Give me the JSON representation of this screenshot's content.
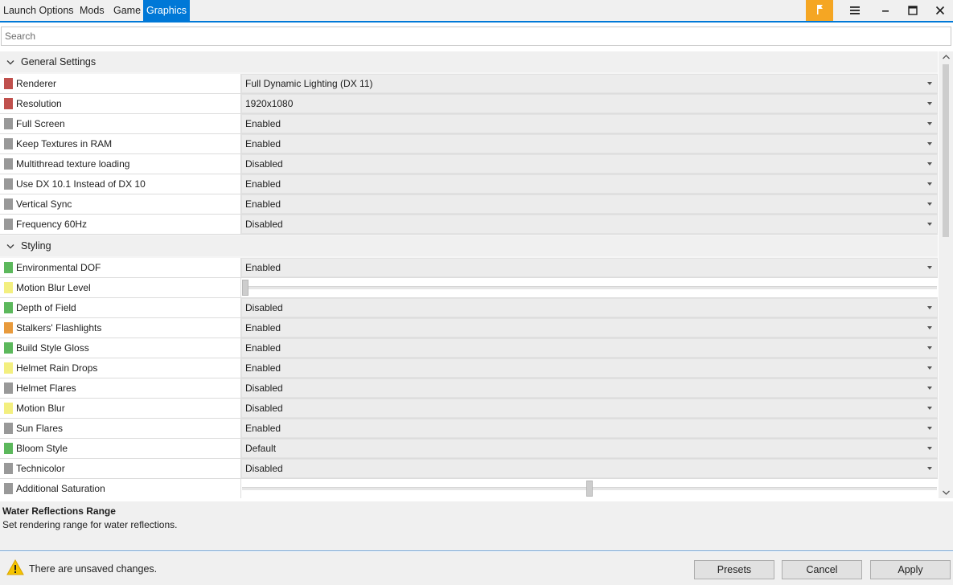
{
  "tabs": [
    {
      "label": "Launch Options"
    },
    {
      "label": "Mods"
    },
    {
      "label": "Game"
    },
    {
      "label": "Graphics",
      "active": true
    }
  ],
  "window_buttons": [
    "flag-icon",
    "menu-icon",
    "minimize-icon",
    "maximize-icon",
    "close-icon"
  ],
  "search": {
    "placeholder": "Search",
    "value": ""
  },
  "categories": [
    {
      "label": "General Settings"
    },
    {
      "label": "Styling"
    }
  ],
  "general_rows": [
    {
      "name": "Renderer",
      "value": "Full Dynamic Lighting (DX 11)",
      "color": "#c0504d"
    },
    {
      "name": "Resolution",
      "value": "1920x1080",
      "color": "#c0504d"
    },
    {
      "name": "Full Screen",
      "value": "Enabled",
      "color": "#999999"
    },
    {
      "name": "Keep Textures in RAM",
      "value": "Enabled",
      "color": "#999999"
    },
    {
      "name": "Multithread texture loading",
      "value": "Disabled",
      "color": "#999999"
    },
    {
      "name": "Use DX 10.1 Instead of DX 10",
      "value": "Enabled",
      "color": "#999999"
    },
    {
      "name": "Vertical Sync",
      "value": "Enabled",
      "color": "#999999"
    },
    {
      "name": "Frequency 60Hz",
      "value": "Disabled",
      "color": "#999999"
    }
  ],
  "styling_rows": [
    {
      "name": "Environmental DOF",
      "value": "Enabled",
      "color": "#5cb85c"
    },
    {
      "name": "Motion Blur Level",
      "slider": 0.0,
      "color": "#f3ef7f"
    },
    {
      "name": "Depth of Field",
      "value": "Disabled",
      "color": "#5cb85c"
    },
    {
      "name": "Stalkers' Flashlights",
      "value": "Enabled",
      "color": "#e89a3c"
    },
    {
      "name": "Build Style Gloss",
      "value": "Enabled",
      "color": "#5cb85c"
    },
    {
      "name": "Helmet Rain Drops",
      "value": "Enabled",
      "color": "#f3ef7f"
    },
    {
      "name": "Helmet Flares",
      "value": "Disabled",
      "color": "#999999"
    },
    {
      "name": "Motion Blur",
      "value": "Disabled",
      "color": "#f3ef7f"
    },
    {
      "name": "Sun Flares",
      "value": "Enabled",
      "color": "#999999"
    },
    {
      "name": "Bloom Style",
      "value": "Default",
      "color": "#5cb85c"
    },
    {
      "name": "Technicolor",
      "value": "Disabled",
      "color": "#999999"
    },
    {
      "name": "Additional Saturation",
      "slider": 0.5,
      "color": "#999999"
    }
  ],
  "description": {
    "title": "Water Reflections Range",
    "text": "Set rendering range for water reflections."
  },
  "footer": {
    "warning": "There are unsaved changes.",
    "buttons": {
      "presets": "Presets",
      "cancel": "Cancel",
      "apply": "Apply"
    }
  },
  "colors": {
    "accent": "#0078d7",
    "flag": "#f5a623"
  }
}
